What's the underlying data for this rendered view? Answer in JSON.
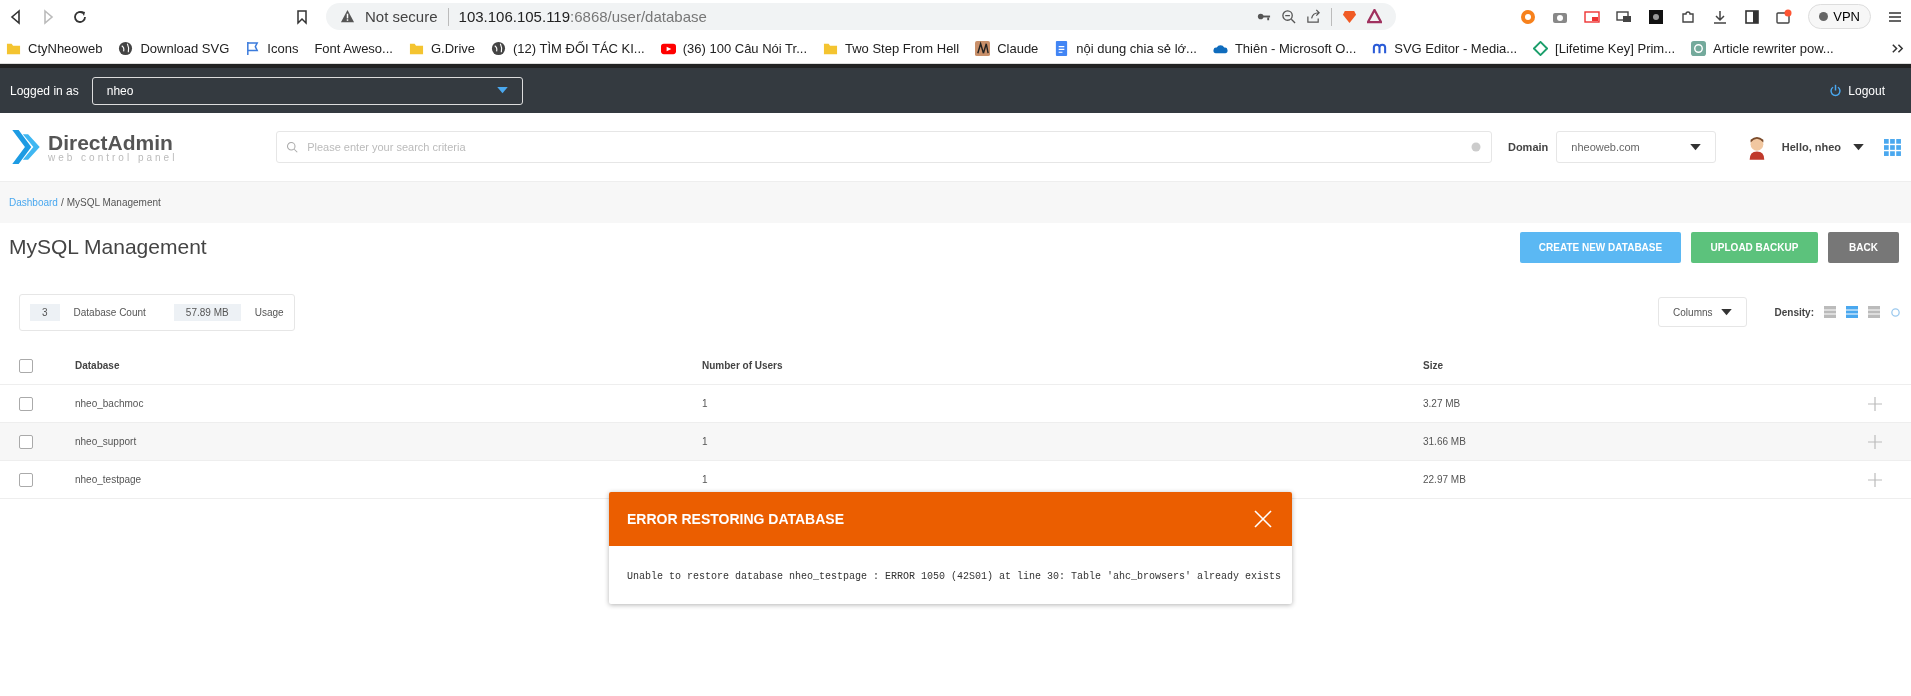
{
  "browser": {
    "security": "Not secure",
    "url_host": "103.106.105.119",
    "url_path": ":6868/user/database",
    "vpn": "VPN"
  },
  "bookmarks": [
    {
      "kind": "folder",
      "label": "CtyNheoweb"
    },
    {
      "kind": "site",
      "label": "Download SVG"
    },
    {
      "kind": "site",
      "label": "Icons"
    },
    {
      "kind": "plain",
      "label": "Font Aweso..."
    },
    {
      "kind": "folder",
      "label": "G.Drive"
    },
    {
      "kind": "site",
      "label": "(12) TÌM ĐỐI TÁC KI..."
    },
    {
      "kind": "site",
      "label": "(36) 100 Câu Nói Tr..."
    },
    {
      "kind": "folder",
      "label": "Two Step From Hell"
    },
    {
      "kind": "site",
      "label": "Claude"
    },
    {
      "kind": "site",
      "label": "nội dung chia sẻ lớ..."
    },
    {
      "kind": "site",
      "label": "Thiên - Microsoft O..."
    },
    {
      "kind": "site",
      "label": "SVG Editor - Media..."
    },
    {
      "kind": "site",
      "label": "[Lifetime Key] Prim..."
    },
    {
      "kind": "site",
      "label": "Article rewriter pow..."
    }
  ],
  "topbar": {
    "label": "Logged in as",
    "user": "nheo",
    "logout": "Logout"
  },
  "header": {
    "logo": "DirectAdmin",
    "tagline": "web control panel",
    "search_placeholder": "Please enter your search criteria",
    "domain_label": "Domain",
    "domain": "nheoweb.com",
    "greeting": "Hello, nheo"
  },
  "breadcrumb": [
    {
      "label": "Dashboard",
      "kind": "link"
    },
    {
      "label": "/",
      "kind": "separator"
    },
    {
      "label": "MySQL Management",
      "kind": "current"
    }
  ],
  "page_title": "MySQL Management",
  "actions": [
    {
      "label": "CREATE NEW DATABASE",
      "kind": "primary"
    },
    {
      "label": "UPLOAD BACKUP",
      "kind": "success"
    },
    {
      "label": "BACK",
      "kind": "neutral"
    }
  ],
  "stats": [
    {
      "value": "3",
      "label": "Database Count"
    },
    {
      "value": "57.89 MB",
      "label": "Usage"
    }
  ],
  "columns_button": "Columns",
  "density": {
    "label": "Density:",
    "options": [
      {
        "selected": false
      },
      {
        "selected": true
      },
      {
        "selected": false
      }
    ]
  },
  "table": {
    "select_all": {
      "checked": false
    },
    "columns": [
      "Database",
      "Number of Users",
      "Size"
    ],
    "rows": [
      {
        "checked": false,
        "cells": [
          "nheo_bachmoc",
          "1",
          "3.27 MB"
        ]
      },
      {
        "checked": false,
        "cells": [
          "nheo_support",
          "1",
          "31.66 MB"
        ]
      },
      {
        "checked": false,
        "cells": [
          "nheo_testpage",
          "1",
          "22.97 MB"
        ]
      }
    ]
  },
  "modal": {
    "title": "ERROR RESTORING DATABASE",
    "message": "Unable to restore database nheo_testpage : ERROR 1050 (42S01) at line 30: Table 'ahc_browsers' already exists"
  }
}
